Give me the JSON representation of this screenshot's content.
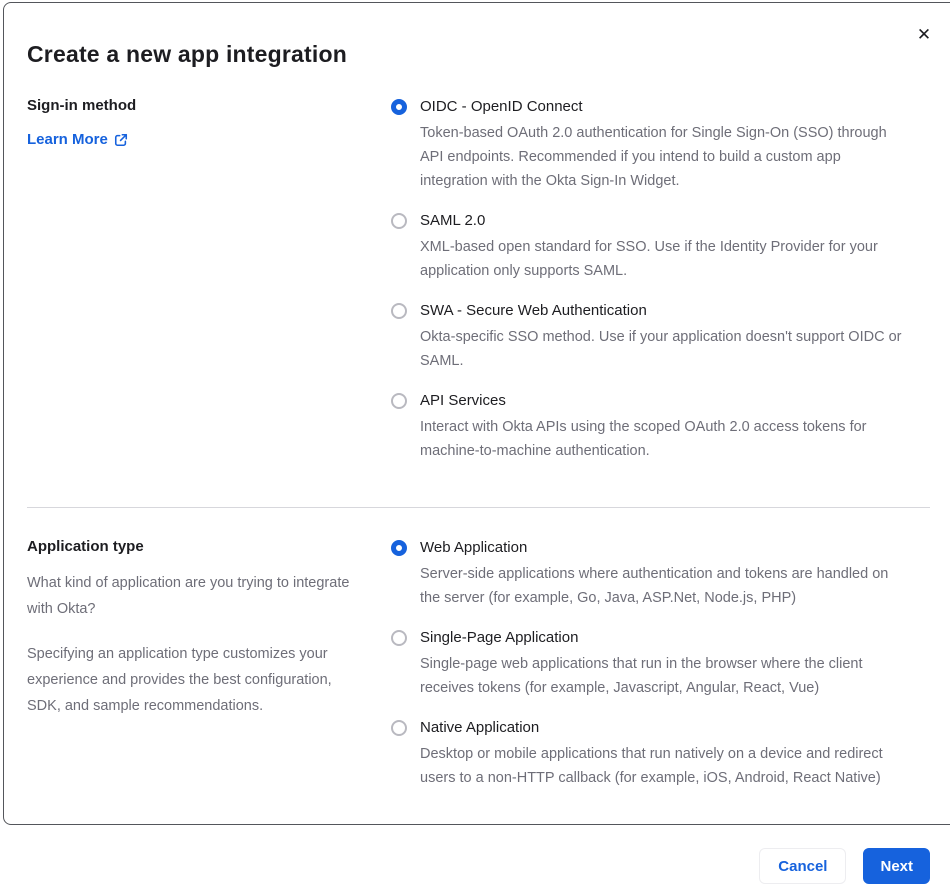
{
  "dialog": {
    "title": "Create a new app integration",
    "close_icon": "✕"
  },
  "signin_section": {
    "label": "Sign-in method",
    "learn_more_label": "Learn More",
    "options": [
      {
        "label": "OIDC - OpenID Connect",
        "description": "Token-based OAuth 2.0 authentication for Single Sign-On (SSO) through API endpoints. Recommended if you intend to build a custom app integration with the Okta Sign-In Widget.",
        "selected": true
      },
      {
        "label": "SAML 2.0",
        "description": "XML-based open standard for SSO. Use if the Identity Provider for your application only supports SAML.",
        "selected": false
      },
      {
        "label": "SWA - Secure Web Authentication",
        "description": "Okta-specific SSO method. Use if your application doesn't support OIDC or SAML.",
        "selected": false
      },
      {
        "label": "API Services",
        "description": "Interact with Okta APIs using the scoped OAuth 2.0 access tokens for machine-to-machine authentication.",
        "selected": false
      }
    ]
  },
  "apptype_section": {
    "label": "Application type",
    "intro_1": "What kind of application are you trying to integrate with Okta?",
    "intro_2": "Specifying an application type customizes your experience and provides the best configuration, SDK, and sample recommendations.",
    "options": [
      {
        "label": "Web Application",
        "description": "Server-side applications where authentication and tokens are handled on the server (for example, Go, Java, ASP.Net, Node.js, PHP)",
        "selected": true
      },
      {
        "label": "Single-Page Application",
        "description": "Single-page web applications that run in the browser where the client receives tokens (for example, Javascript, Angular, React, Vue)",
        "selected": false
      },
      {
        "label": "Native Application",
        "description": "Desktop or mobile applications that run natively on a device and redirect users to a non-HTTP callback (for example, iOS, Android, React Native)",
        "selected": false
      }
    ]
  },
  "footer": {
    "cancel_label": "Cancel",
    "next_label": "Next"
  },
  "colors": {
    "primary_blue": "#1662dd",
    "heading_text": "#1d1d21",
    "body_text": "#6e6e78",
    "divider": "#d7d7dc",
    "radio_unselected_border": "#b9b9c0",
    "modal_border": "#54565b"
  }
}
